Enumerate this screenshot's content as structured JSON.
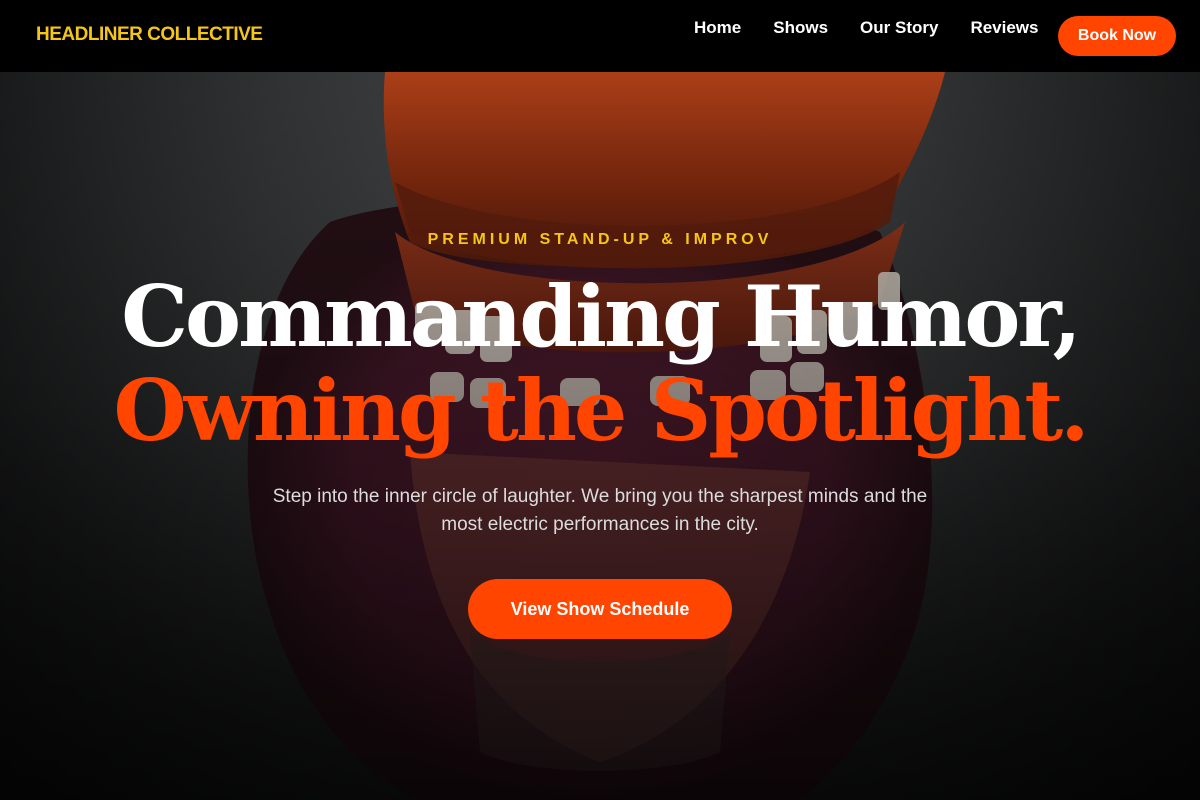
{
  "navbar": {
    "logo": "HEADLINER COLLECTIVE",
    "links": [
      "Home",
      "Shows",
      "Our Story",
      "Reviews"
    ],
    "cta_label": "Book Now"
  },
  "hero": {
    "eyebrow": "PREMIUM STAND-UP & IMPROV",
    "headline_line1": "Commanding Humor,",
    "headline_line2": "Owning the Spotlight.",
    "subtext": "Step into the inner circle of laughter. We bring you the sharpest minds and the most electric performances in the city.",
    "cta_label": "View Show Schedule",
    "background_image": "chattering-teeth-toy-photo"
  },
  "colors": {
    "accent": "#ff4500",
    "logo_gold": "#f5c518",
    "nav_background": "#000000"
  }
}
